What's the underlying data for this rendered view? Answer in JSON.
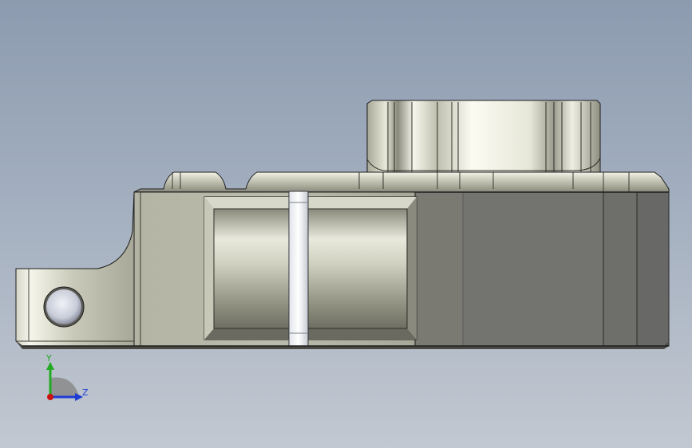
{
  "viewport": {
    "background_top": "#8d9bb0",
    "background_bottom": "#c2c8d1",
    "model_body_color": "#bfbfad",
    "model_shadow_color": "#7a7a6e",
    "model_highlight_color": "#f2f2e6",
    "edge_color": "#1e1e1e"
  },
  "triad": {
    "y_label": "Y",
    "z_label": "Z",
    "y_color": "#22aa22",
    "z_color": "#1e3cd2",
    "x_color": "#cc1111"
  }
}
